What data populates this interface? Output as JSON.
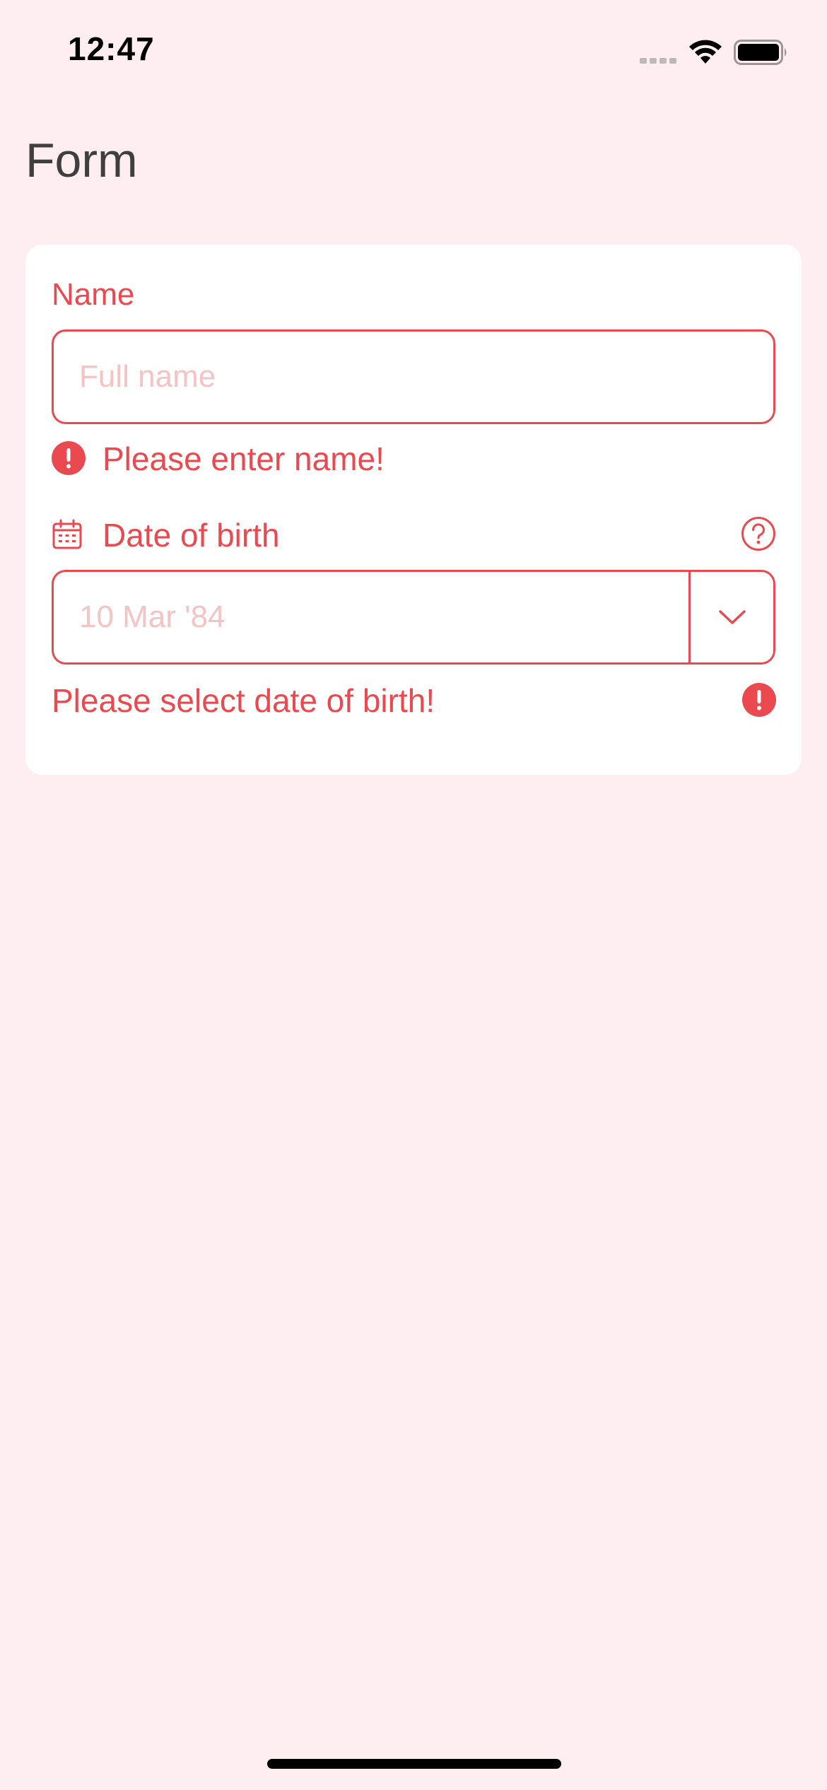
{
  "status_bar": {
    "time": "12:47"
  },
  "page": {
    "title": "Form"
  },
  "form": {
    "name_label": "Name",
    "name_placeholder": "Full name",
    "name_value": "",
    "name_error": "Please enter name!",
    "dob_label": "Date of birth",
    "dob_placeholder": "10 Mar '84",
    "dob_error": "Please select date of birth!"
  },
  "icons": {
    "name_error": "exclamation-circle-icon",
    "dob_label": "calendar-icon",
    "dob_help": "question-circle-icon",
    "dob_toggle": "chevron-down-icon",
    "dob_error": "exclamation-circle-icon"
  },
  "colors": {
    "background": "#feeef2",
    "error": "#ea4a4f",
    "placeholder": "#f6c3c5",
    "title": "#3f3f3f",
    "card": "#ffffff"
  }
}
